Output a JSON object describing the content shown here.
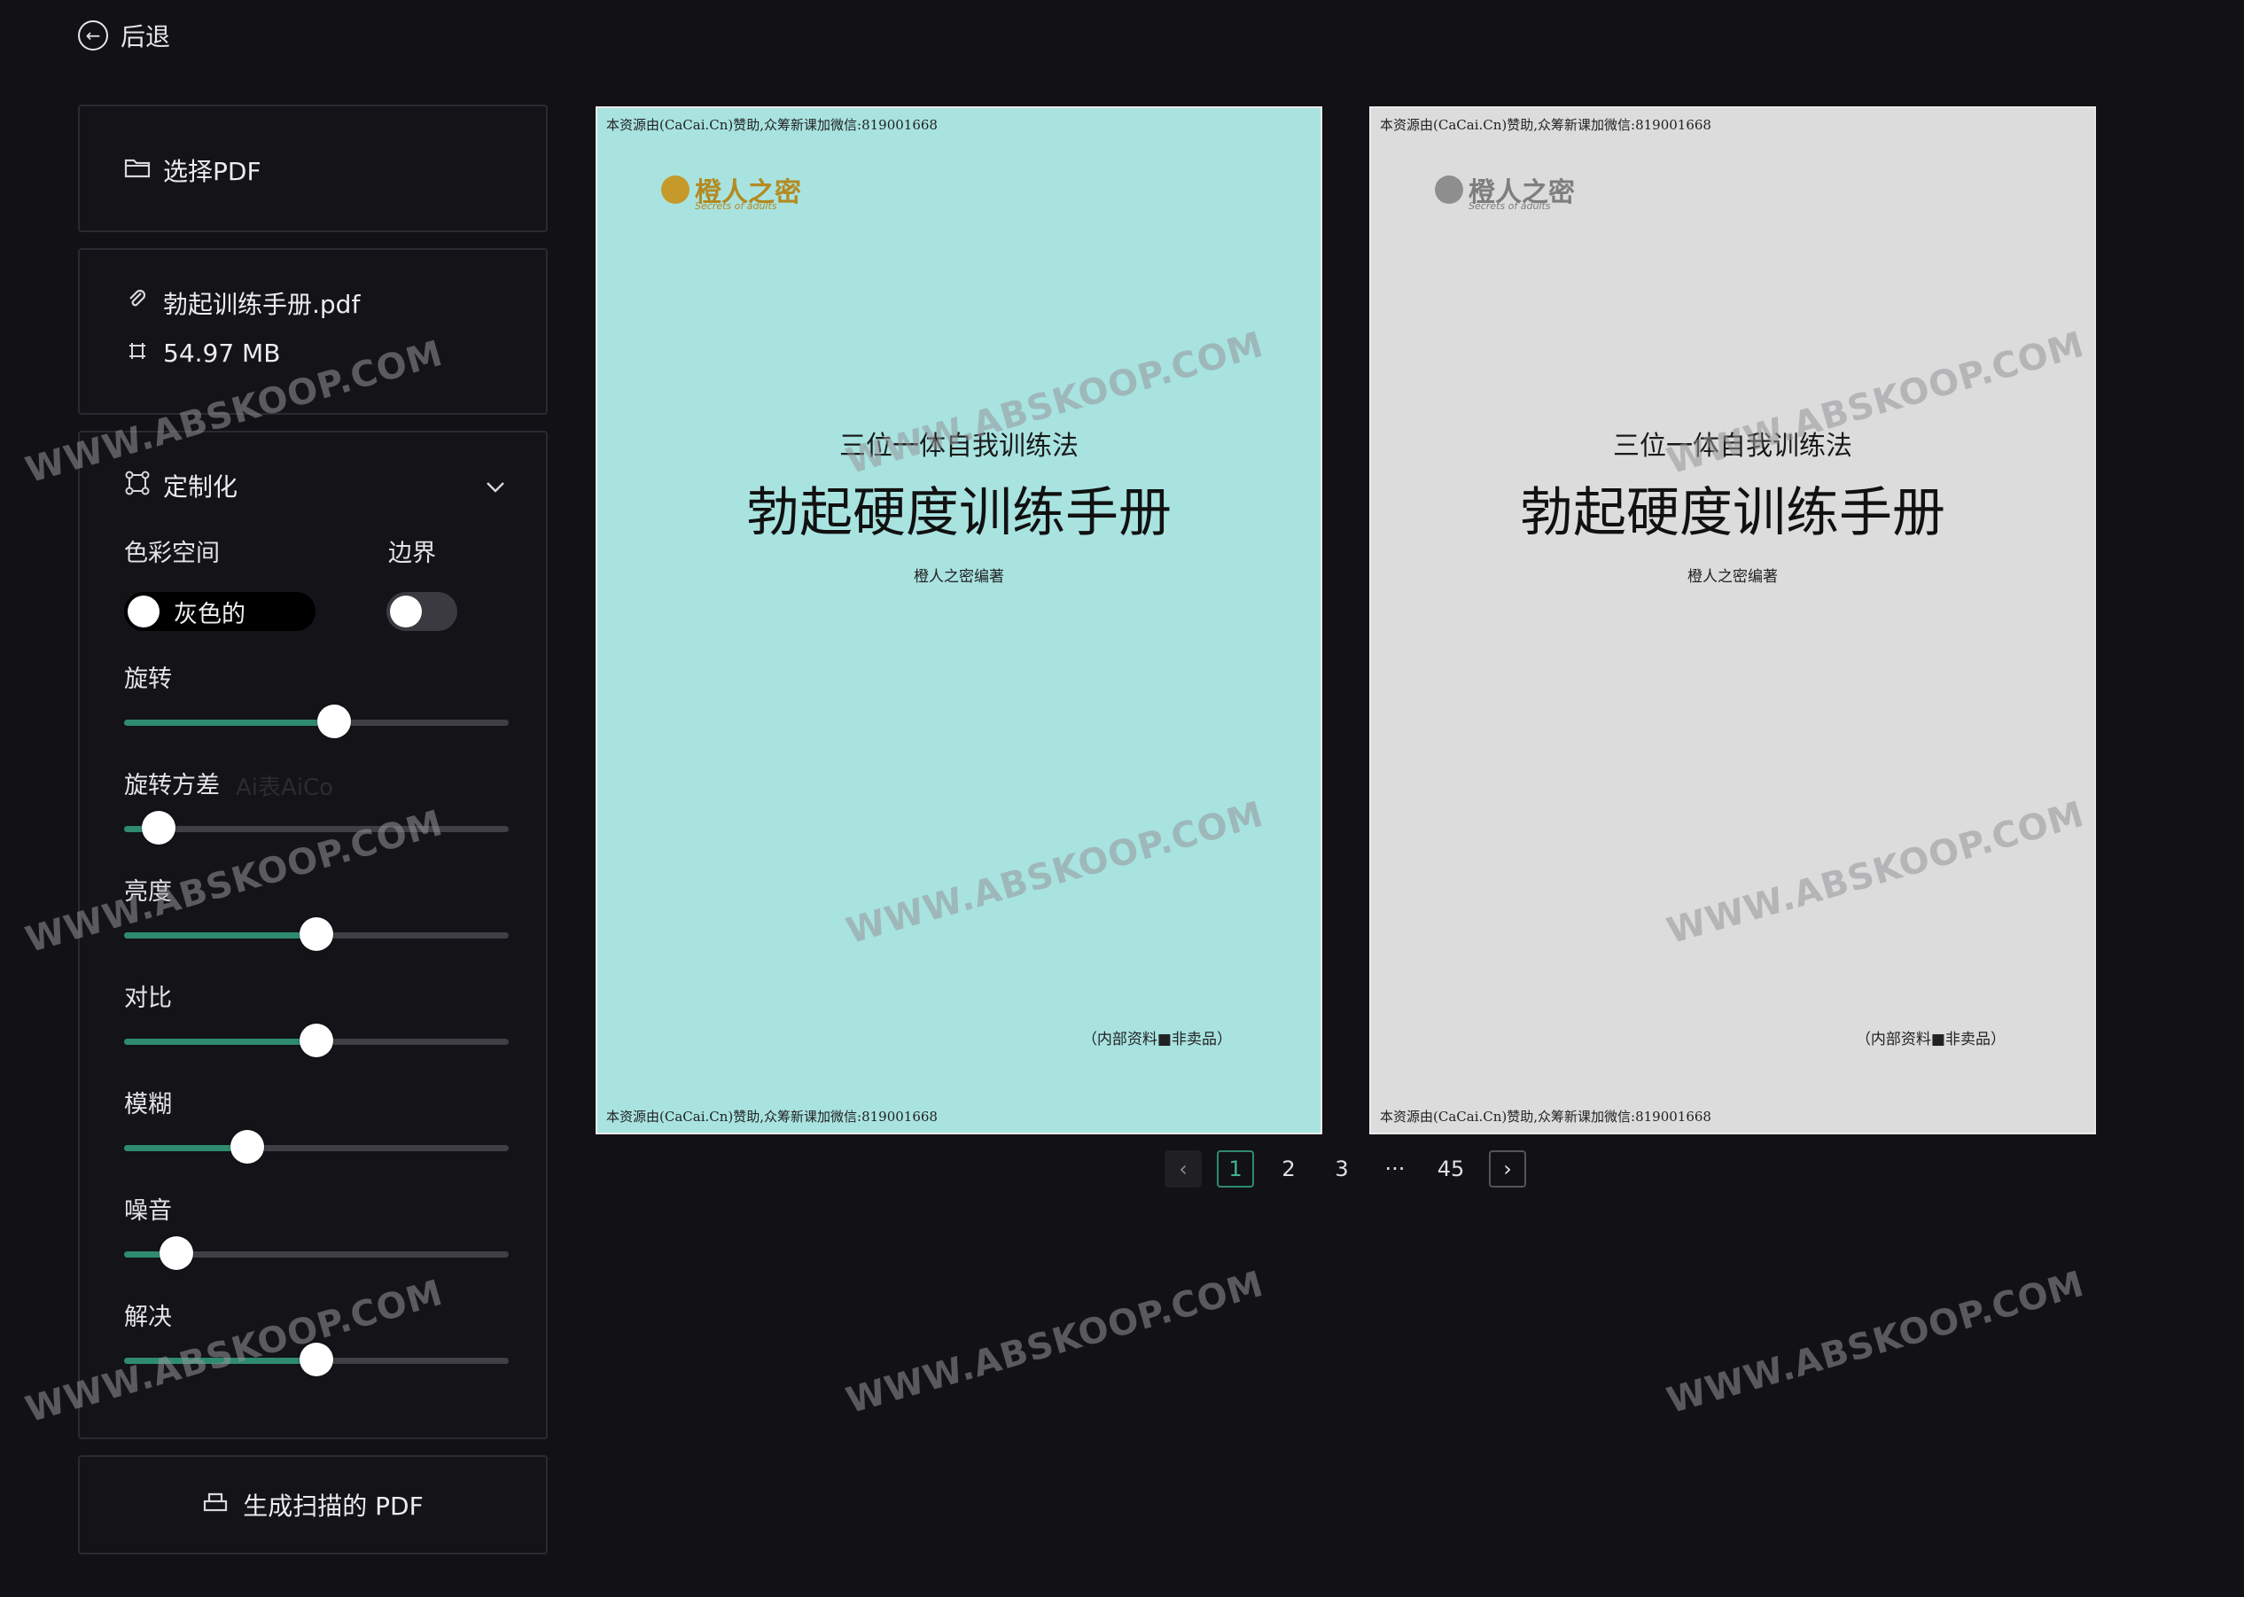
{
  "nav": {
    "back_label": "后退"
  },
  "select_panel": {
    "button_label": "选择PDF"
  },
  "file_info": {
    "name": "勃起训练手册.pdf",
    "size": "54.97 MB"
  },
  "custom_panel": {
    "title": "定制化",
    "color_space_label": "色彩空间",
    "color_space_value": "灰色的",
    "border_label": "边界",
    "border_on": false,
    "sliders": [
      {
        "label": "旋转",
        "value": 0.545
      },
      {
        "label": "旋转方差",
        "value": 0.09
      },
      {
        "label": "亮度",
        "value": 0.5
      },
      {
        "label": "对比",
        "value": 0.5
      },
      {
        "label": "模糊",
        "value": 0.32
      },
      {
        "label": "噪音",
        "value": 0.135
      },
      {
        "label": "解决",
        "value": 0.5
      }
    ],
    "faint_text": "Ai表AiCo"
  },
  "generate": {
    "label": "生成扫描的 PDF"
  },
  "pages": {
    "left": {
      "top_note": "本资源由(CaCai.Cn)赞助,众筹新课加微信:819001668",
      "logo_name": "橙人之密",
      "logo_sub": "Secrets of adults",
      "subtitle": "三位一体自我训练法",
      "title": "勃起硬度训练手册",
      "author": "橙人之密编著",
      "footer": "（内部资料■非卖品）",
      "bottom_note": "本资源由(CaCai.Cn)赞助,众筹新课加微信:819001668"
    },
    "right": {
      "top_note": "本资源由(CaCai.Cn)赞助,众筹新课加微信:819001668",
      "logo_name": "橙人之密",
      "logo_sub": "Secrets of adults",
      "subtitle": "三位一体自我训练法",
      "title": "勃起硬度训练手册",
      "author": "橙人之密编著",
      "footer": "（内部资料■非卖品）",
      "bottom_note": "本资源由(CaCai.Cn)赞助,众筹新课加微信:819001668"
    }
  },
  "pagination": {
    "prev": "‹",
    "pages": [
      "1",
      "2",
      "3",
      "···",
      "45"
    ],
    "current": "1",
    "next": "›"
  },
  "watermark": "WWW.ABSKOOP.COM",
  "colors": {
    "accent": "#2e8b6e",
    "background": "#111116",
    "panel_border": "#2a2a30",
    "page_left_bg": "#a8e3e0",
    "page_right_bg": "#dcdcdc"
  }
}
